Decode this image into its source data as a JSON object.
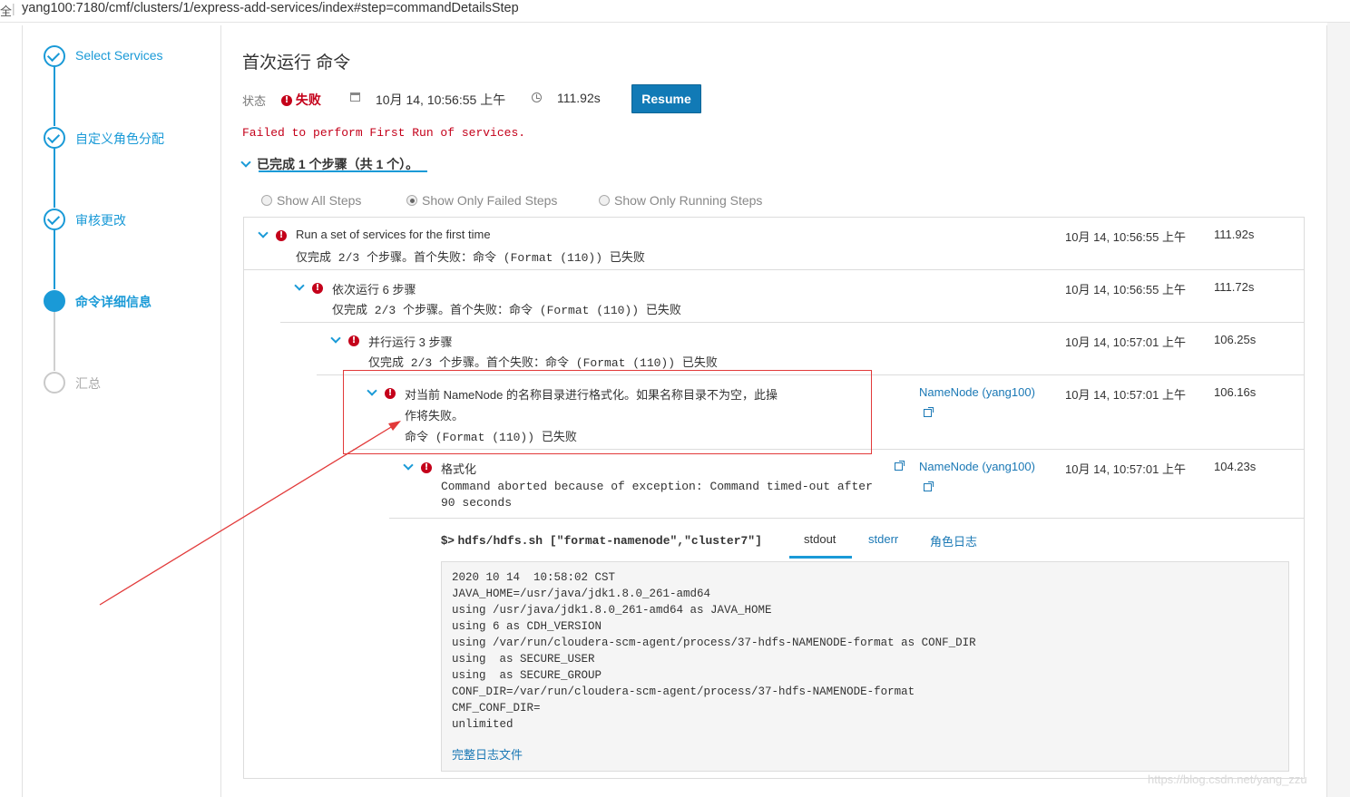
{
  "browser": {
    "lock_glyph": "全",
    "url": "yang100:7180/cmf/clusters/1/express-add-services/index#step=commandDetailsStep"
  },
  "wizard": {
    "steps": [
      {
        "label": "Select Services",
        "state": "done"
      },
      {
        "label": "自定义角色分配",
        "state": "done"
      },
      {
        "label": "审核更改",
        "state": "done"
      },
      {
        "label": "命令详细信息",
        "state": "active"
      },
      {
        "label": "汇总",
        "state": "pending"
      }
    ]
  },
  "command": {
    "title": "首次运行 命令",
    "status_label": "状态",
    "status_value": "失败",
    "date": "10月 14, 10:56:55 上午",
    "duration": "111.92s",
    "resume_label": "Resume",
    "failure_message": "Failed to perform First Run of services.",
    "summary": "已完成 1 个步骤（共 1 个）。"
  },
  "filters": {
    "all": "Show All Steps",
    "failed": "Show Only Failed Steps",
    "running": "Show Only Running Steps",
    "selected": "failed"
  },
  "steps": [
    {
      "title": "Run a set of services for the first time",
      "sub": "仅完成 2/3 个步骤。首个失败：命令 (Format (110)) 已失败",
      "time": "10月 14, 10:56:55 上午",
      "duration": "111.92s"
    },
    {
      "title": "依次运行 6 步骤",
      "sub": "仅完成 2/3 个步骤。首个失败：命令 (Format (110)) 已失败",
      "time": "10月 14, 10:56:55 上午",
      "duration": "111.72s"
    },
    {
      "title": "并行运行 3 步骤",
      "sub": "仅完成 2/3 个步骤。首个失败：命令 (Format (110)) 已失败",
      "time": "10月 14, 10:57:01 上午",
      "duration": "106.25s"
    },
    {
      "title_line1": "对当前 NameNode 的名称目录进行格式化。如果名称目录不为空，此操",
      "title_line2": "作将失败。",
      "sub": "命令 (Format (110)) 已失败",
      "link": "NameNode (yang100)",
      "time": "10月 14, 10:57:01 上午",
      "duration": "106.16s"
    },
    {
      "title": "格式化",
      "sub_line1": "Command aborted because of exception: Command timed-out after",
      "sub_line2": "90 seconds",
      "link": "NameNode (yang100)",
      "time": "10月 14, 10:57:01 上午",
      "duration": "104.23s"
    }
  ],
  "output": {
    "prompt": "$>",
    "command": "hdfs/hdfs.sh [\"format-namenode\",\"cluster7\"]",
    "tabs": [
      "stdout",
      "stderr",
      "角色日志"
    ],
    "active_tab": "stdout",
    "log": "2020 10 14  10:58:02 CST\nJAVA_HOME=/usr/java/jdk1.8.0_261-amd64\nusing /usr/java/jdk1.8.0_261-amd64 as JAVA_HOME\nusing 6 as CDH_VERSION\nusing /var/run/cloudera-scm-agent/process/37-hdfs-NAMENODE-format as CONF_DIR\nusing  as SECURE_USER\nusing  as SECURE_GROUP\nCONF_DIR=/var/run/cloudera-scm-agent/process/37-hdfs-NAMENODE-format\nCMF_CONF_DIR=\nunlimited",
    "full_log_link": "完整日志文件"
  },
  "watermark": "https://blog.csdn.net/yang_zzu",
  "colors": {
    "accent": "#1a9ad7",
    "error": "#c4001a",
    "button": "#117ab6",
    "annotation": "#e23a3a"
  }
}
